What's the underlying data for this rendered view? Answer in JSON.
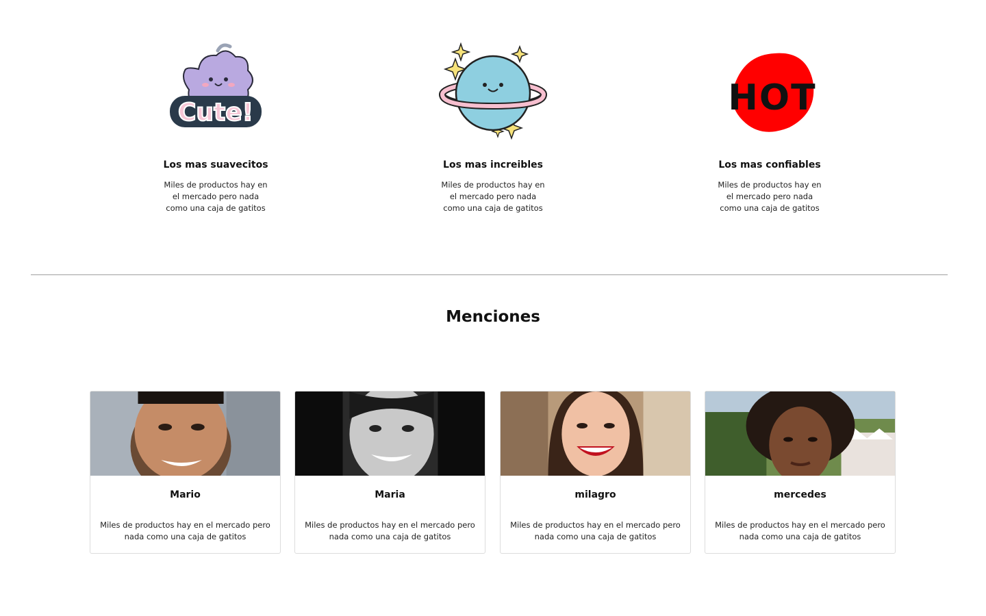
{
  "features": [
    {
      "title": "Los mas suavecitos",
      "text": "Miles de productos hay en el mercado pero nada como una caja de gatitos",
      "icon": "cute-sticker-icon"
    },
    {
      "title": "Los mas increibles",
      "text": "Miles de productos hay en el mercado pero nada como una caja de gatitos",
      "icon": "planet-sticker-icon"
    },
    {
      "title": "Los mas confiables",
      "text": "Miles de productos hay en el mercado pero nada como una caja de gatitos",
      "icon": "hot-sticker-icon"
    }
  ],
  "stickers": {
    "cute_text": "Cute!",
    "hot_text": "HOT"
  },
  "mentions": {
    "title": "Menciones",
    "cards": [
      {
        "name": "Mario",
        "text": "Miles de productos hay en el mercado pero nada como una caja de gatitos"
      },
      {
        "name": "Maria",
        "text": "Miles de productos hay en el mercado pero nada como una caja de gatitos"
      },
      {
        "name": "milagro",
        "text": "Miles de productos hay en el mercado pero nada como una caja de gatitos"
      },
      {
        "name": "mercedes",
        "text": "Miles de productos hay en el mercado pero nada como una caja de gatitos"
      }
    ]
  },
  "colors": {
    "hot_red": "#ff0000",
    "planet_blue": "#8ecfe0",
    "ring_pink": "#f7bfcf",
    "cute_purple": "#b9a9e0",
    "divider": "#9e9e9e"
  }
}
